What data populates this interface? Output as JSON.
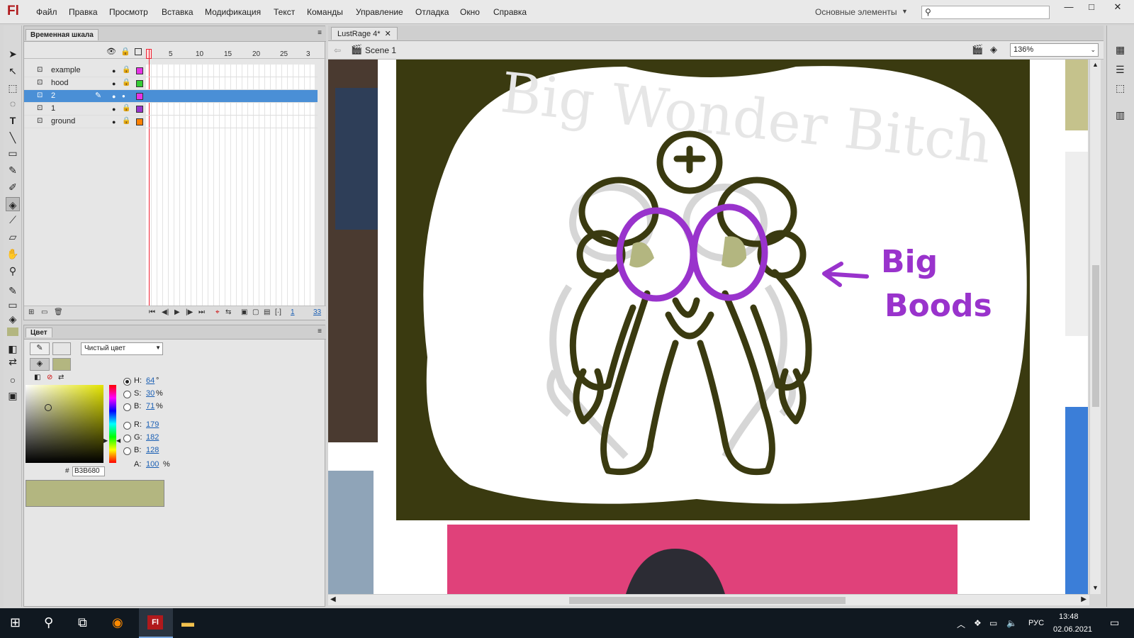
{
  "app": {
    "logo": "Fl"
  },
  "menu": [
    "Файл",
    "Правка",
    "Просмотр",
    "Вставка",
    "Модификация",
    "Текст",
    "Команды",
    "Управление",
    "Отладка",
    "Окно",
    "Справка"
  ],
  "workspace": "Основные элементы",
  "window_buttons": [
    "—",
    "□",
    "✕"
  ],
  "timeline": {
    "tab": "Временная шкала",
    "frame_numbers": [
      "1",
      "5",
      "10",
      "15",
      "20",
      "25",
      "3"
    ],
    "layers": [
      {
        "name": "example",
        "color": "#e633e6",
        "selected": false
      },
      {
        "name": "hood",
        "color": "#33cc33",
        "selected": false
      },
      {
        "name": "2",
        "color": "#e633e6",
        "selected": true
      },
      {
        "name": "1",
        "color": "#9933cc",
        "selected": false
      },
      {
        "name": "ground",
        "color": "#ff8000",
        "selected": false
      }
    ],
    "current_frame": "1",
    "fps": "33"
  },
  "color_panel": {
    "tab": "Цвет",
    "fill_type": "Чистый цвет",
    "H": "64",
    "S": "30",
    "B": "71",
    "R": "179",
    "G": "182",
    "Bv": "128",
    "A": "100",
    "hex_label": "#",
    "hex": "B3B680",
    "deg": "°",
    "pct": "%",
    "fill_color": "#b3b680"
  },
  "document": {
    "tab": "LustRage 4*",
    "tab_close": "✕",
    "scene": "Scene 1",
    "zoom": "136%"
  },
  "artwork": {
    "watermark": "Big Wonder Bitch",
    "annotation_line1": "Big",
    "annotation_line2": "Boods",
    "ink_color": "#3a3a10",
    "accent_color": "#9933cc"
  },
  "taskbar": {
    "time": "13:48",
    "date": "02.06.2021",
    "lang": "РУС"
  }
}
